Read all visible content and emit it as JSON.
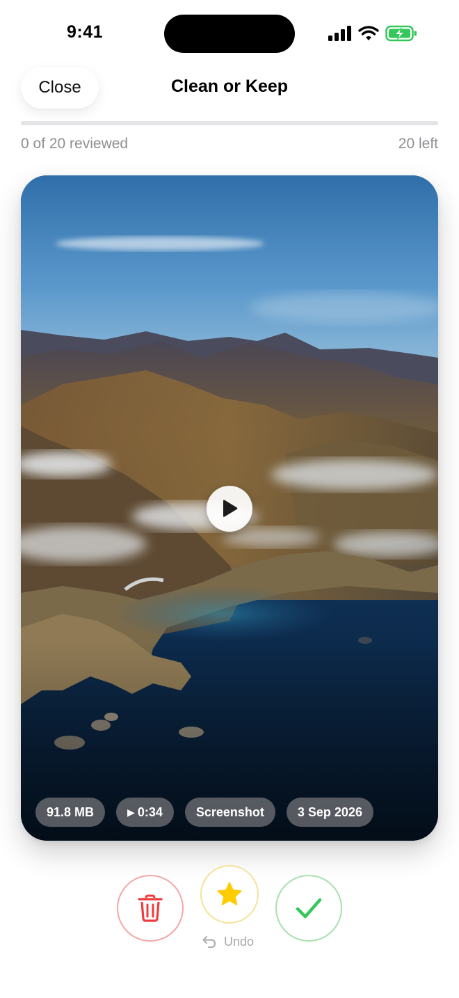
{
  "status_bar": {
    "time": "9:41",
    "icons": [
      "signal-icon",
      "wifi-icon",
      "battery-charging-icon"
    ],
    "battery_color": "#34c759"
  },
  "header": {
    "close_label": "Close",
    "title": "Clean or Keep"
  },
  "progress": {
    "reviewed_text": "0 of 20 reviewed",
    "left_text": "20 left",
    "reviewed": 0,
    "total": 20
  },
  "media": {
    "type": "video",
    "play_icon": "play-icon",
    "tags": {
      "size": "91.8 MB",
      "duration_glyph": "▶",
      "duration": "0:34",
      "kind": "Screenshot",
      "date": "3 Sep 2026"
    }
  },
  "actions": {
    "delete_icon": "trash-icon",
    "favorite_icon": "star-icon",
    "keep_icon": "checkmark-icon",
    "undo_label": "Undo",
    "colors": {
      "delete": "#ef3b3e",
      "favorite": "#ffcc00",
      "keep": "#34c759"
    }
  }
}
